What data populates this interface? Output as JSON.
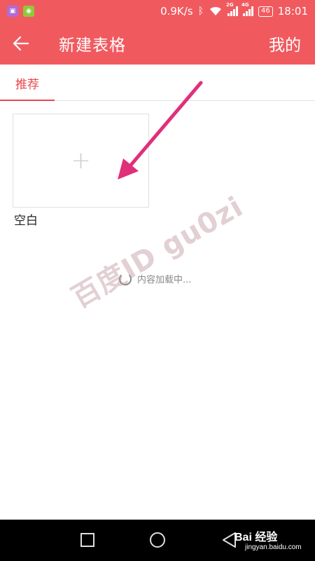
{
  "status_bar": {
    "network_speed": "0.9K/s",
    "sim1_tag": "2G",
    "sim2_tag": "4G",
    "battery": "46",
    "time": "18:01"
  },
  "app_bar": {
    "title": "新建表格",
    "right_action": "我的"
  },
  "tabs": [
    {
      "label": "推荐",
      "selected": true
    }
  ],
  "templates": [
    {
      "label": "空白"
    }
  ],
  "loading_text": "内容加载中...",
  "watermark": "百度ID gu0zi",
  "brand": {
    "name": "Bai 经验",
    "url": "jingyan.baidu.com"
  },
  "colors": {
    "accent": "#f05a5f",
    "tab_active": "#e8474d",
    "arrow": "#e0307a"
  }
}
